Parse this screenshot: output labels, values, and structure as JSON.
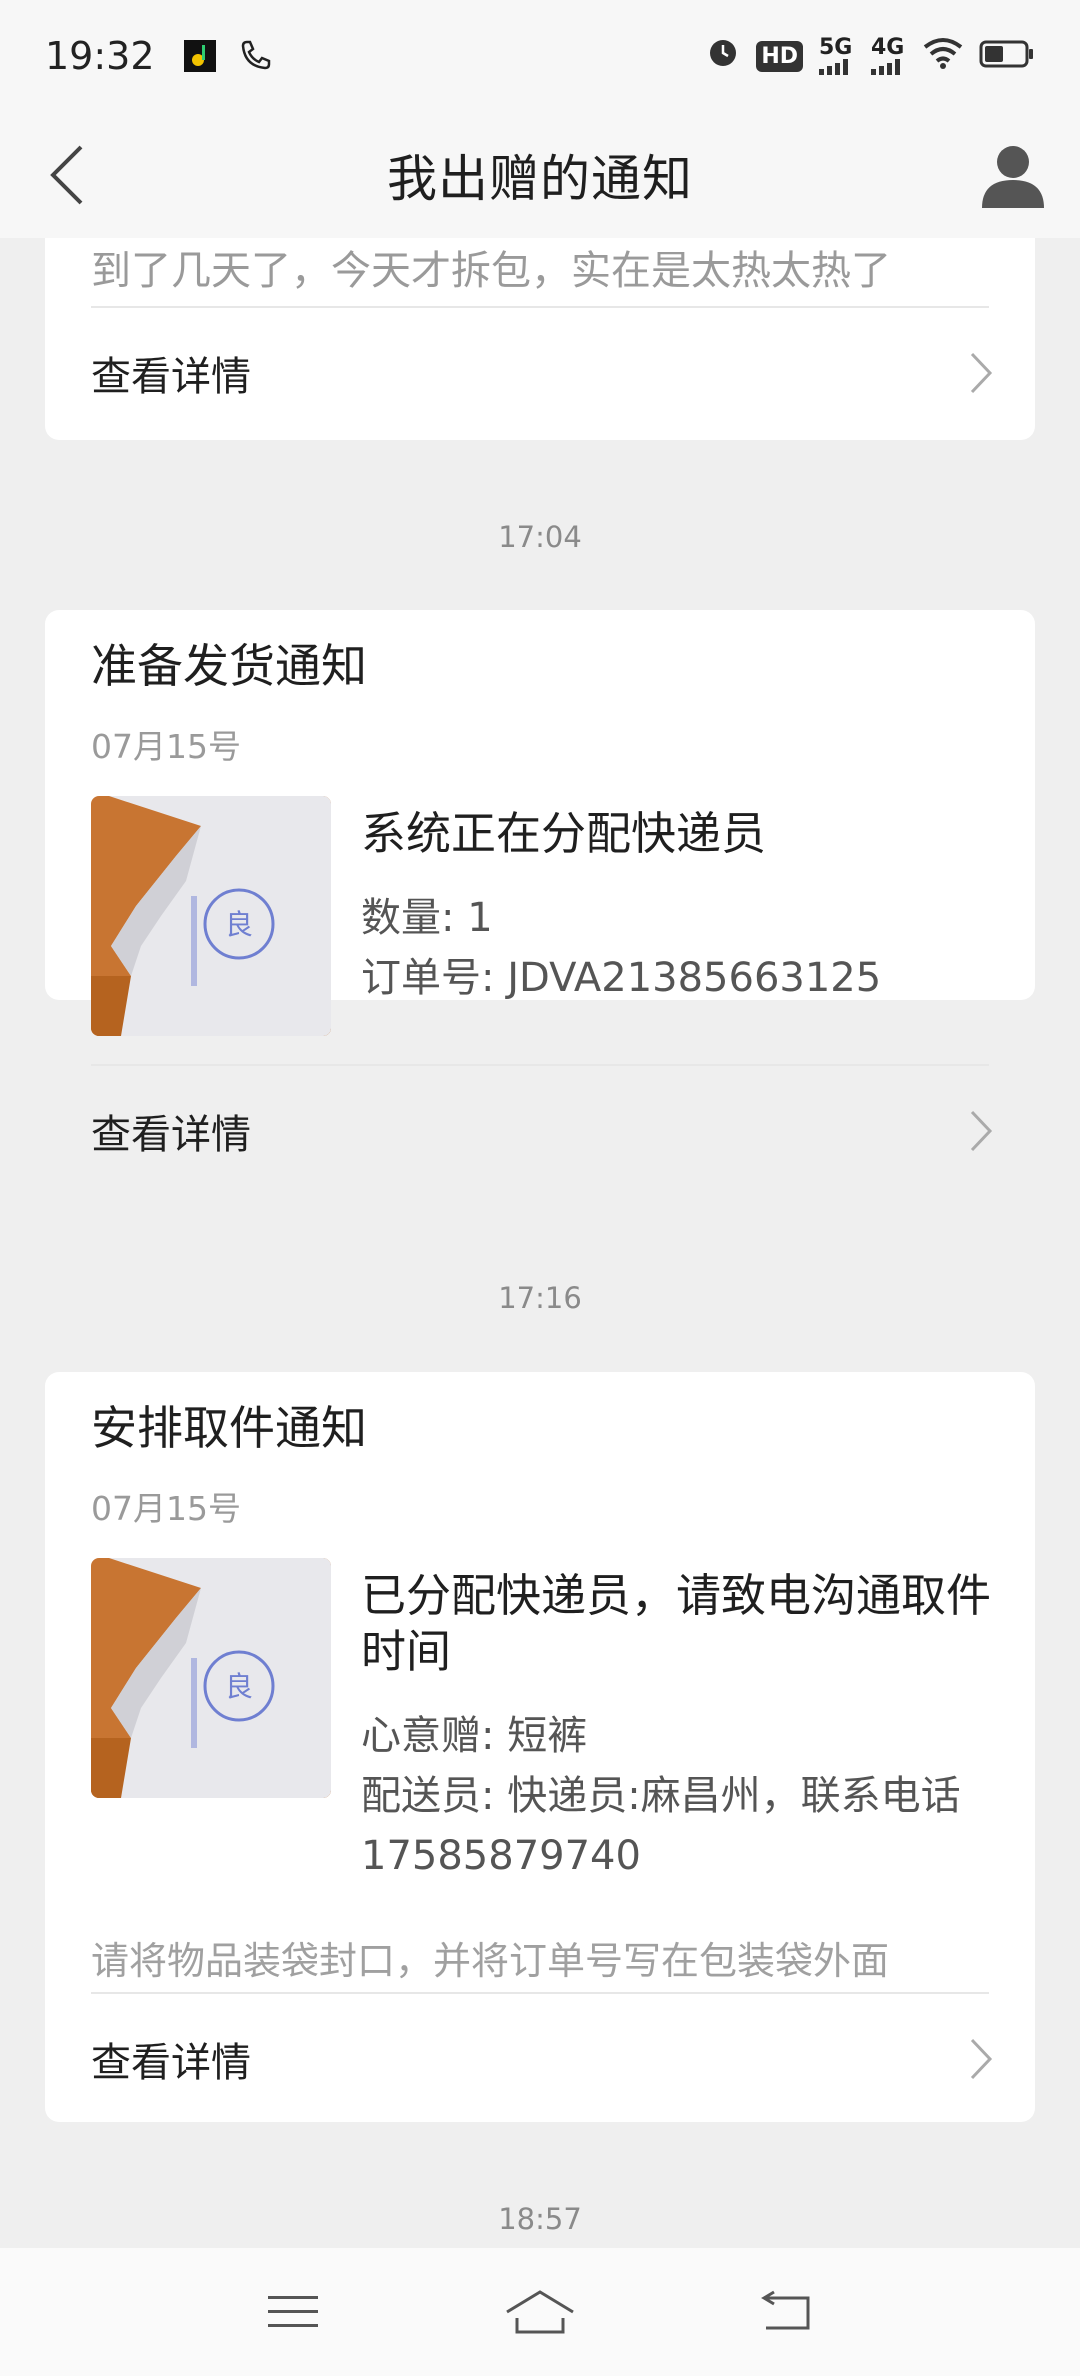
{
  "status_bar": {
    "time": "19:32",
    "hd_label": "HD",
    "signal_5g": "5G",
    "signal_4g": "4G"
  },
  "header": {
    "title": "我出赠的通知"
  },
  "partial_card": {
    "snippet": "到了几天了，今天才拆包，实在是太热太热了",
    "detail_label": "查看详情"
  },
  "sections": [
    {
      "time": "17:04",
      "title": "准备发货通知",
      "date": "07月15号",
      "main_text": "系统正在分配快递员",
      "meta": [
        "数量: 1",
        "订单号: JDVA21385663125"
      ],
      "detail_label": "查看详情"
    },
    {
      "time": "17:16",
      "title": "安排取件通知",
      "date": "07月15号",
      "main_text": "已分配快递员，请致电沟通取件时间",
      "meta": [
        "心意赠: 短裤",
        "配送员: 快递员:麻昌州，联系电话17585879740"
      ],
      "hint": "请将物品装袋封口，并将订单号写在包装袋外面",
      "detail_label": "查看详情"
    }
  ],
  "next_time": "18:57",
  "colors": {
    "background": "#efefef",
    "card": "#ffffff",
    "accent_text": "#1f1f1f",
    "muted": "#9a9a9a"
  }
}
